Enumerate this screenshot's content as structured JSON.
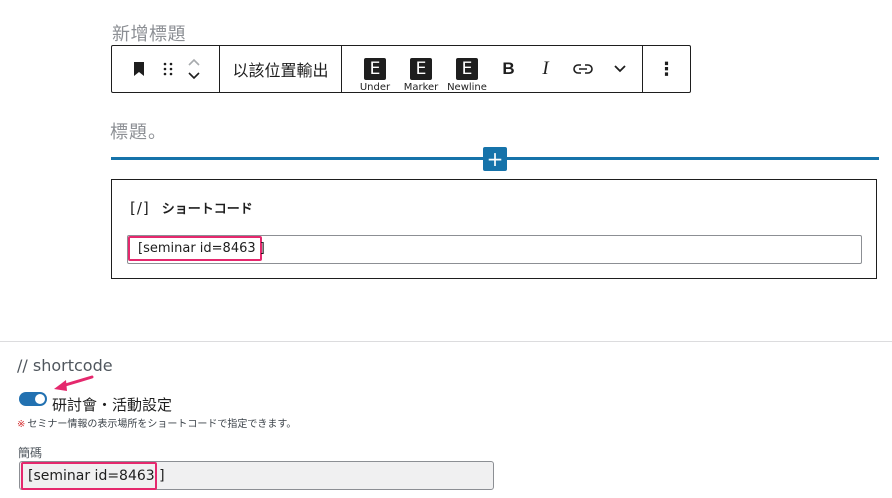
{
  "editor": {
    "heading_placeholder": "新增標題",
    "title_placeholder": "標題。",
    "toolbar": {
      "align_label": "以該位置輸出",
      "e_buttons": [
        {
          "glyph": "E",
          "label": "Under"
        },
        {
          "glyph": "E",
          "label": "Marker"
        },
        {
          "glyph": "E",
          "label": "Newline"
        }
      ],
      "bold": "B",
      "italic": "I",
      "more_options": "⋮"
    },
    "inserter": "+",
    "shortcode_block": {
      "icon": "[/]",
      "title": "ショートコード",
      "value": "[seminar id=8463 ]"
    }
  },
  "meta": {
    "section_title": "// shortcode",
    "toggle_label": "研討會・活動設定",
    "toggle_on": true,
    "note_star": "※",
    "note": "セミナー情報の表示場所をショートコードで指定できます。",
    "field_label": "簡碼",
    "field_value": "[seminar id=8463 ]"
  },
  "colors": {
    "accent": "#1673aa",
    "highlight": "#e5286d",
    "toggle": "#2271b1"
  }
}
